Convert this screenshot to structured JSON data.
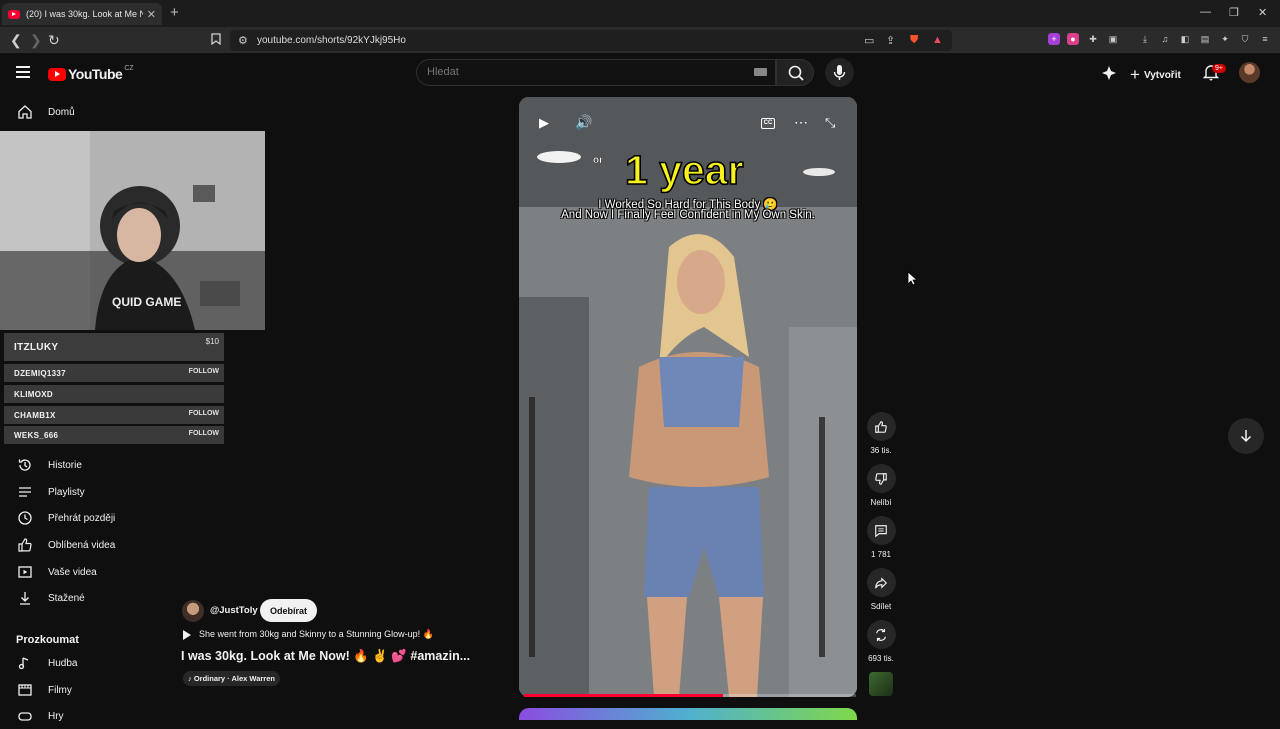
{
  "browser": {
    "tab_title": "(20) I was 30kg. Look at Me Now! #amazing",
    "url": "youtube.com/shorts/92kYJkj95Ho",
    "ext_badge": "+"
  },
  "header": {
    "logo_text": "YouTube",
    "logo_region": "CZ",
    "search_placeholder": "Hledat",
    "create_label": "Vytvořit",
    "notifications_badge": "9+"
  },
  "sidebar": {
    "top_items": [
      {
        "label": "Domů",
        "icon": "home-icon"
      }
    ],
    "you_items": [
      {
        "label": "Historie",
        "icon": "history-icon"
      },
      {
        "label": "Playlisty",
        "icon": "playlist-icon"
      },
      {
        "label": "Přehrát později",
        "icon": "clock-icon"
      },
      {
        "label": "Oblíbená videa",
        "icon": "thumbs-up-icon"
      },
      {
        "label": "Vaše videa",
        "icon": "video-icon"
      },
      {
        "label": "Stažené",
        "icon": "download-icon"
      }
    ],
    "explore_heading": "Prozkoumat",
    "explore_items": [
      {
        "label": "Hudba",
        "icon": "music-icon"
      },
      {
        "label": "Filmy",
        "icon": "film-icon"
      },
      {
        "label": "Hry",
        "icon": "gamepad-icon"
      }
    ]
  },
  "stream_overlay": {
    "top_donor": {
      "name": "ITZLUKY",
      "amount": "$10"
    },
    "followers": [
      {
        "name": "DZEMIQ1337",
        "action": "FOLLOW"
      },
      {
        "name": "KLIMOXD",
        "action": ""
      },
      {
        "name": "CHAMB1X",
        "action": "FOLLOW"
      },
      {
        "name": "WEKS_666",
        "action": "FOLLOW"
      }
    ],
    "hoodie_text": "QUID GAME"
  },
  "video": {
    "overlay_small": "or",
    "overlay_big": "1 year",
    "caption_line1": "I Worked So Hard for This Body 🥲",
    "caption_line2": "And Now I Finally Feel Confident in My Own Skin.",
    "cc_label": "CC",
    "progress": 0.6
  },
  "actions": {
    "likes": "36 tis.",
    "dislike_label": "Nelíbí",
    "comments": "1 781",
    "share_label": "Sdílet",
    "remix": "693 tis."
  },
  "meta": {
    "channel": "@JustToly",
    "subscribe_label": "Odebírat",
    "description": "She went from 30kg and Skinny to a Stunning Glow-up! 🔥",
    "title": "I was 30kg. Look at Me Now! 🔥 ✌️ 💕 #amazin...",
    "music": "♪ Ordinary · Alex Warren"
  },
  "colors": {
    "background": "#0f0f0f",
    "brand_red": "#ff0000",
    "overlay_yellow": "#f7f21a"
  }
}
